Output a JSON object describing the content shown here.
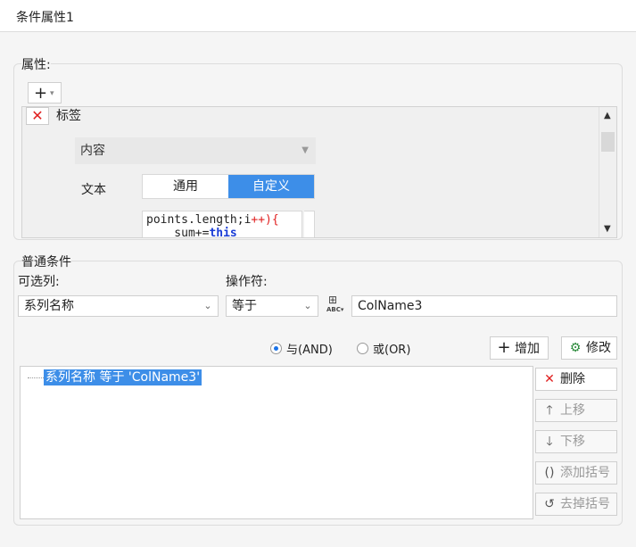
{
  "window": {
    "title": "条件属性1"
  },
  "properties": {
    "legend": "属性:",
    "tag_label": "标签",
    "content_select": "内容",
    "text_label": "文本",
    "segments": [
      "通用",
      "自定义"
    ],
    "code_line1_a": "points.length;i",
    "code_line1_b": "++){",
    "code_line2_a": "    sum+=",
    "code_line2_b": "this"
  },
  "conditions": {
    "legend": "普通条件",
    "column_label": "可选列:",
    "column_value": "系列名称",
    "operator_label": "操作符:",
    "operator_value": "等于",
    "value": "ColName3",
    "radio_and": "与(AND)",
    "radio_or": "或(OR)",
    "add_label": "增加",
    "modify_label": "修改",
    "list_item": "系列名称 等于 'ColName3'",
    "delete_label": "删除",
    "up_label": "上移",
    "down_label": "下移",
    "add_bracket_label": "添加括号",
    "remove_bracket_label": "去掉括号"
  }
}
